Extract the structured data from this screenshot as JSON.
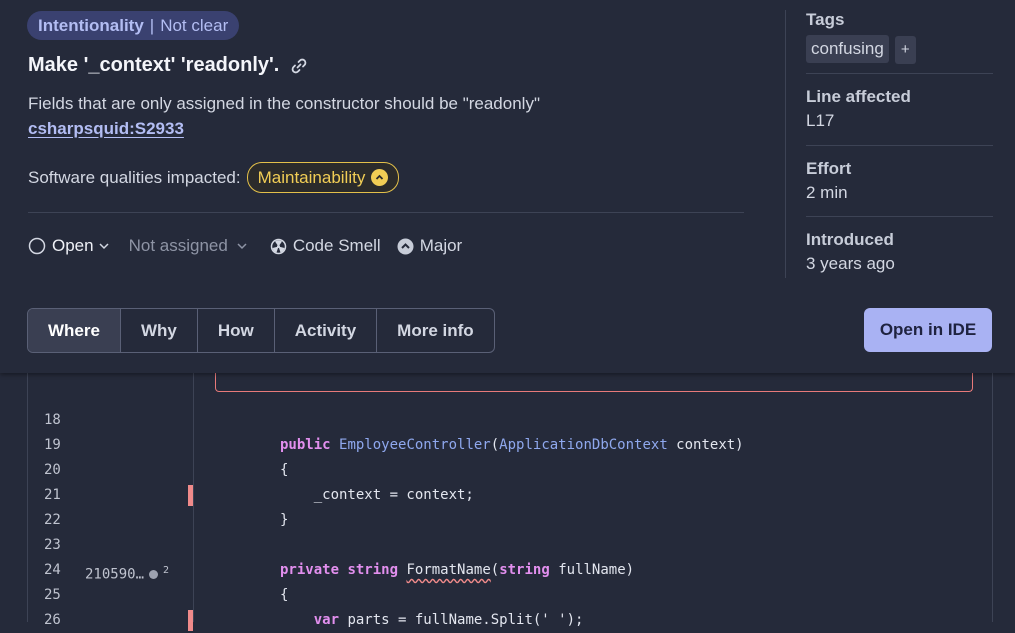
{
  "issue": {
    "attribute": "Intentionality",
    "attribute_sub": "Not clear",
    "title": "Make '_context' 'readonly'.",
    "description": "Fields that are only assigned in the constructor should be \"readonly\"",
    "rule_key": "csharpsquid:S2933",
    "qualities_label": "Software qualities impacted:",
    "quality": "Maintainability",
    "status": "Open",
    "assignee": "Not assigned",
    "type": "Code Smell",
    "severity": "Major"
  },
  "tabs": [
    "Where",
    "Why",
    "How",
    "Activity",
    "More info"
  ],
  "open_in_ide": "Open in IDE",
  "side": {
    "tags_label": "Tags",
    "tag": "confusing",
    "tag_add": "+",
    "line_label": "Line affected",
    "line_value": "L17",
    "effort_label": "Effort",
    "effort_value": "2 min",
    "introduced_label": "Introduced",
    "introduced_value": "3 years ago"
  },
  "code": {
    "scm_24": "210590…",
    "scm_24_count": "2",
    "lines": [
      {
        "n": "18"
      },
      {
        "n": "19",
        "t1": "public",
        "t2": "EmployeeController",
        "t3": "(",
        "t4": "ApplicationDbContext",
        "t5": " context)"
      },
      {
        "n": "20",
        "t": "{"
      },
      {
        "n": "21",
        "t": "    _context = context;"
      },
      {
        "n": "22",
        "t": "}"
      },
      {
        "n": "23"
      },
      {
        "n": "24",
        "t1": "private",
        "t2": "string",
        "t3": "FormatName",
        "t4": "(",
        "t5": "string",
        "t6": " fullName)"
      },
      {
        "n": "25",
        "t": "{"
      },
      {
        "n": "26",
        "t1": "var",
        "t2": " parts = fullName.Split(' ');"
      }
    ]
  },
  "colors": {
    "accent": "#a9b2f3",
    "quality": "#f1cd55",
    "error": "#f08a8a"
  }
}
